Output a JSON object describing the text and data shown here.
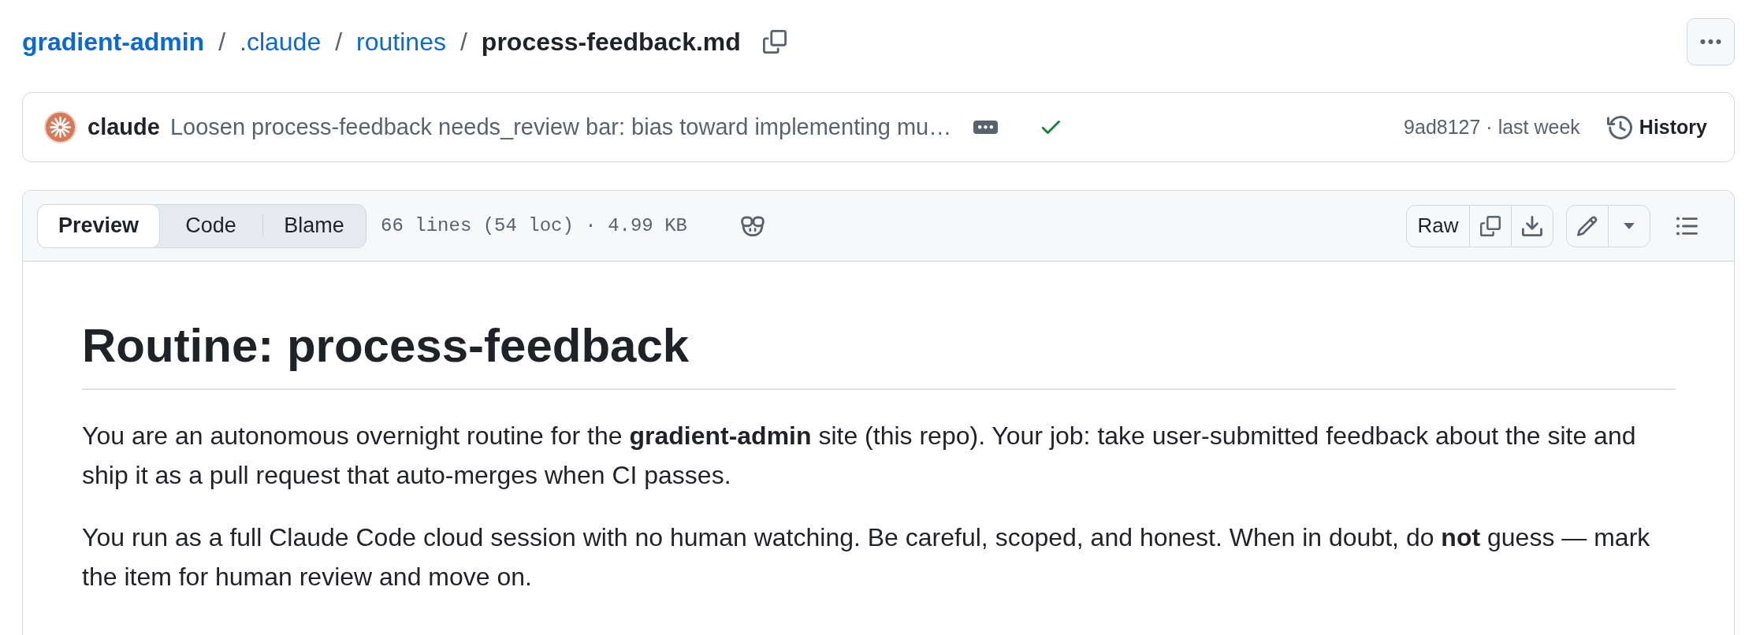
{
  "breadcrumb": [
    {
      "kind": "repo",
      "label": "gradient-admin"
    },
    {
      "kind": "separator",
      "label": "/"
    },
    {
      "kind": "folder",
      "label": ".claude"
    },
    {
      "kind": "separator",
      "label": "/"
    },
    {
      "kind": "folder",
      "label": "routines"
    },
    {
      "kind": "separator",
      "label": "/"
    },
    {
      "kind": "file",
      "label": "process-feedback.md"
    }
  ],
  "commit": {
    "author": "claude",
    "message": "Loosen process-feedback needs_review bar: bias toward implementing mu…",
    "checks_passed": true,
    "meta": "9ad8127 · last week",
    "history_label": "History"
  },
  "file_header": {
    "tabs": [
      {
        "label": "Preview",
        "selected": true
      },
      {
        "label": "Code",
        "selected": false
      },
      {
        "label": "Blame",
        "selected": false
      }
    ],
    "info": "66 lines (54 loc) · 4.99 KB",
    "raw_label": "Raw"
  },
  "document": {
    "heading": "Routine: process-feedback",
    "paragraphs": [
      "You are an autonomous overnight routine for the **gradient-admin** site (this repo). Your job: take user-submitted feedback about the site and ship it as a pull request that auto-merges when CI passes.",
      "You run as a full Claude Code cloud session with no human watching. Be careful, scoped, and honest. When in doubt, do **not** guess — mark the item for human review and move on."
    ]
  }
}
